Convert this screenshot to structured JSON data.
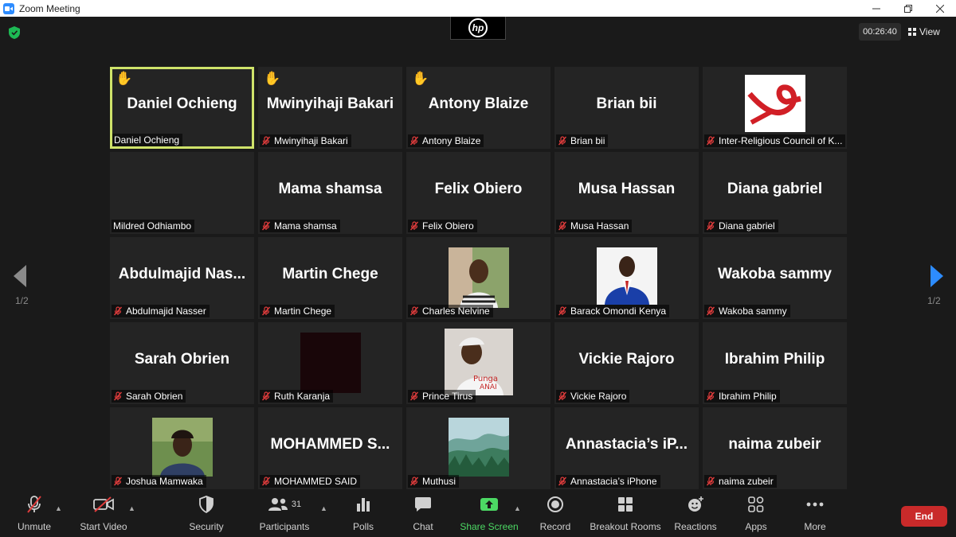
{
  "window": {
    "title": "Zoom Meeting",
    "controls": [
      "minimize",
      "restore",
      "close"
    ]
  },
  "meeting": {
    "timer": "00:26:40",
    "view_label": "View",
    "page_indicator": "1/2",
    "camera_overlay": "hp"
  },
  "participants": [
    {
      "display": "Daniel Ochieng",
      "caption": "Daniel Ochieng",
      "hand_raised": true,
      "muted": false,
      "active": true,
      "video": "none"
    },
    {
      "display": "Mwinyihaji Bakari",
      "caption": "Mwinyihaji Bakari",
      "hand_raised": true,
      "muted": true,
      "video": "none"
    },
    {
      "display": "Antony Blaize",
      "caption": "Antony Blaize",
      "hand_raised": true,
      "muted": true,
      "video": "none"
    },
    {
      "display": "Brian bii",
      "caption": "Brian bii",
      "hand_raised": false,
      "muted": true,
      "video": "none"
    },
    {
      "display": "",
      "caption": "Inter-Religious Council of K...",
      "hand_raised": false,
      "muted": true,
      "video": "logo"
    },
    {
      "display": "",
      "caption": "Mildred Odhiambo",
      "hand_raised": false,
      "muted": false,
      "video": "blank"
    },
    {
      "display": "Mama shamsa",
      "caption": "Mama shamsa",
      "hand_raised": false,
      "muted": true,
      "video": "none"
    },
    {
      "display": "Felix Obiero",
      "caption": "Felix Obiero",
      "hand_raised": false,
      "muted": true,
      "video": "none"
    },
    {
      "display": "Musa Hassan",
      "caption": "Musa Hassan",
      "hand_raised": false,
      "muted": true,
      "video": "none"
    },
    {
      "display": "Diana gabriel",
      "caption": "Diana gabriel",
      "hand_raised": false,
      "muted": true,
      "video": "none"
    },
    {
      "display": "Abdulmajid  Nas...",
      "caption": "Abdulmajid Nasser",
      "hand_raised": false,
      "muted": true,
      "video": "none"
    },
    {
      "display": "Martin Chege",
      "caption": "Martin Chege",
      "hand_raised": false,
      "muted": true,
      "video": "none"
    },
    {
      "display": "",
      "caption": "Charles Nelvine",
      "hand_raised": false,
      "muted": true,
      "video": "photo-charles"
    },
    {
      "display": "",
      "caption": "Barack Omondi Kenya",
      "hand_raised": false,
      "muted": true,
      "video": "photo-barack"
    },
    {
      "display": "Wakoba sammy",
      "caption": "Wakoba sammy",
      "hand_raised": false,
      "muted": true,
      "video": "none"
    },
    {
      "display": "Sarah Obrien",
      "caption": "Sarah Obrien",
      "hand_raised": false,
      "muted": true,
      "video": "none"
    },
    {
      "display": "",
      "caption": "Ruth Karanja",
      "hand_raised": false,
      "muted": true,
      "video": "dark"
    },
    {
      "display": "",
      "caption": "Prince Tirus",
      "hand_raised": false,
      "muted": true,
      "video": "photo-prince"
    },
    {
      "display": "Vickie Rajoro",
      "caption": "Vickie Rajoro",
      "hand_raised": false,
      "muted": true,
      "video": "none"
    },
    {
      "display": "Ibrahim Philip",
      "caption": "Ibrahim Philip",
      "hand_raised": false,
      "muted": true,
      "video": "none"
    },
    {
      "display": "",
      "caption": "Joshua Mamwaka",
      "hand_raised": false,
      "muted": true,
      "video": "photo-joshua"
    },
    {
      "display": "MOHAMMED  S...",
      "caption": "MOHAMMED SAID",
      "hand_raised": false,
      "muted": true,
      "video": "none"
    },
    {
      "display": "",
      "caption": "Muthusi",
      "hand_raised": false,
      "muted": true,
      "video": "photo-landscape"
    },
    {
      "display": "Annastacia’s  iP...",
      "caption": "Annastacia’s iPhone",
      "hand_raised": false,
      "muted": true,
      "video": "none"
    },
    {
      "display": "naima zubeir",
      "caption": "naima zubeir",
      "hand_raised": false,
      "muted": true,
      "video": "none"
    }
  ],
  "toolbar": {
    "unmute": "Unmute",
    "start_video": "Start Video",
    "security": "Security",
    "participants": "Participants",
    "participants_count": "31",
    "polls": "Polls",
    "chat": "Chat",
    "share_screen": "Share Screen",
    "record": "Record",
    "breakout_rooms": "Breakout Rooms",
    "reactions": "Reactions",
    "apps": "Apps",
    "more": "More",
    "end": "End"
  },
  "colors": {
    "active_speaker_border": "#cfe36a",
    "muted_mic": "#e03c3c",
    "share_screen": "#4cd964",
    "end_button": "#c92a2a"
  }
}
